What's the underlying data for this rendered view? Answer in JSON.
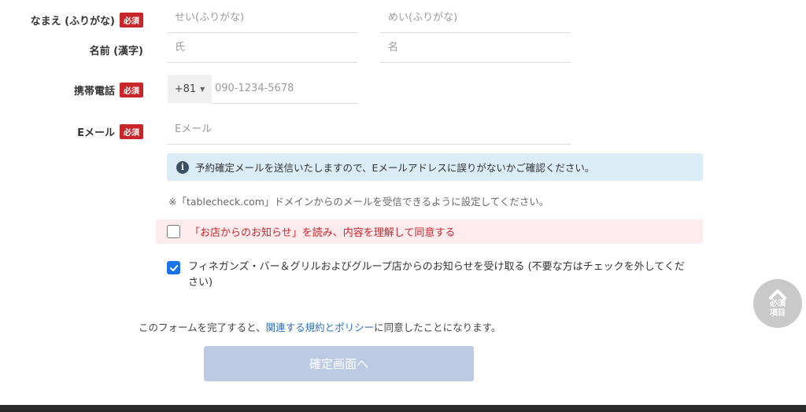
{
  "required_badge": "必須",
  "furigana": {
    "label": "なまえ (ふりがな)",
    "sei_placeholder": "せい(ふりがな)",
    "mei_placeholder": "めい(ふりがな)"
  },
  "kanji_name": {
    "label": "名前 (漢字)",
    "sei_placeholder": "氏",
    "mei_placeholder": "名"
  },
  "phone": {
    "label": "携帯電話",
    "country_code": "+81",
    "placeholder": "090-1234-5678"
  },
  "email": {
    "label": "Eメール",
    "placeholder": "Eメール"
  },
  "info_message": "予約確定メールを送信いたしますので、Eメールアドレスに誤りがないかご確認ください。",
  "domain_note": "※「tablecheck.com」ドメインからのメールを受信できるように設定してください。",
  "agree": {
    "text": "「お店からのお知らせ」を読み、内容を理解して同意する",
    "checked": false
  },
  "optin": {
    "text": "フィネガンズ・バー＆グリルおよびグループ店からのお知らせを受け取る (不要な方はチェックを外してください)",
    "checked": true
  },
  "policy": {
    "prefix": "このフォームを完了すると、",
    "link": "関連する規約とポリシー",
    "suffix": "に同意したことになります。"
  },
  "confirm_button": "確定画面へ",
  "required_fields_button": {
    "line1": "必須",
    "line2": "項目"
  },
  "colors": {
    "required_badge": "#c8262b",
    "info_bg": "#daecf6",
    "agree_bg": "#fdebed",
    "checkbox_checked": "#1a73e8",
    "confirm_button": "#bccbe3",
    "link": "#2a6ebb"
  }
}
